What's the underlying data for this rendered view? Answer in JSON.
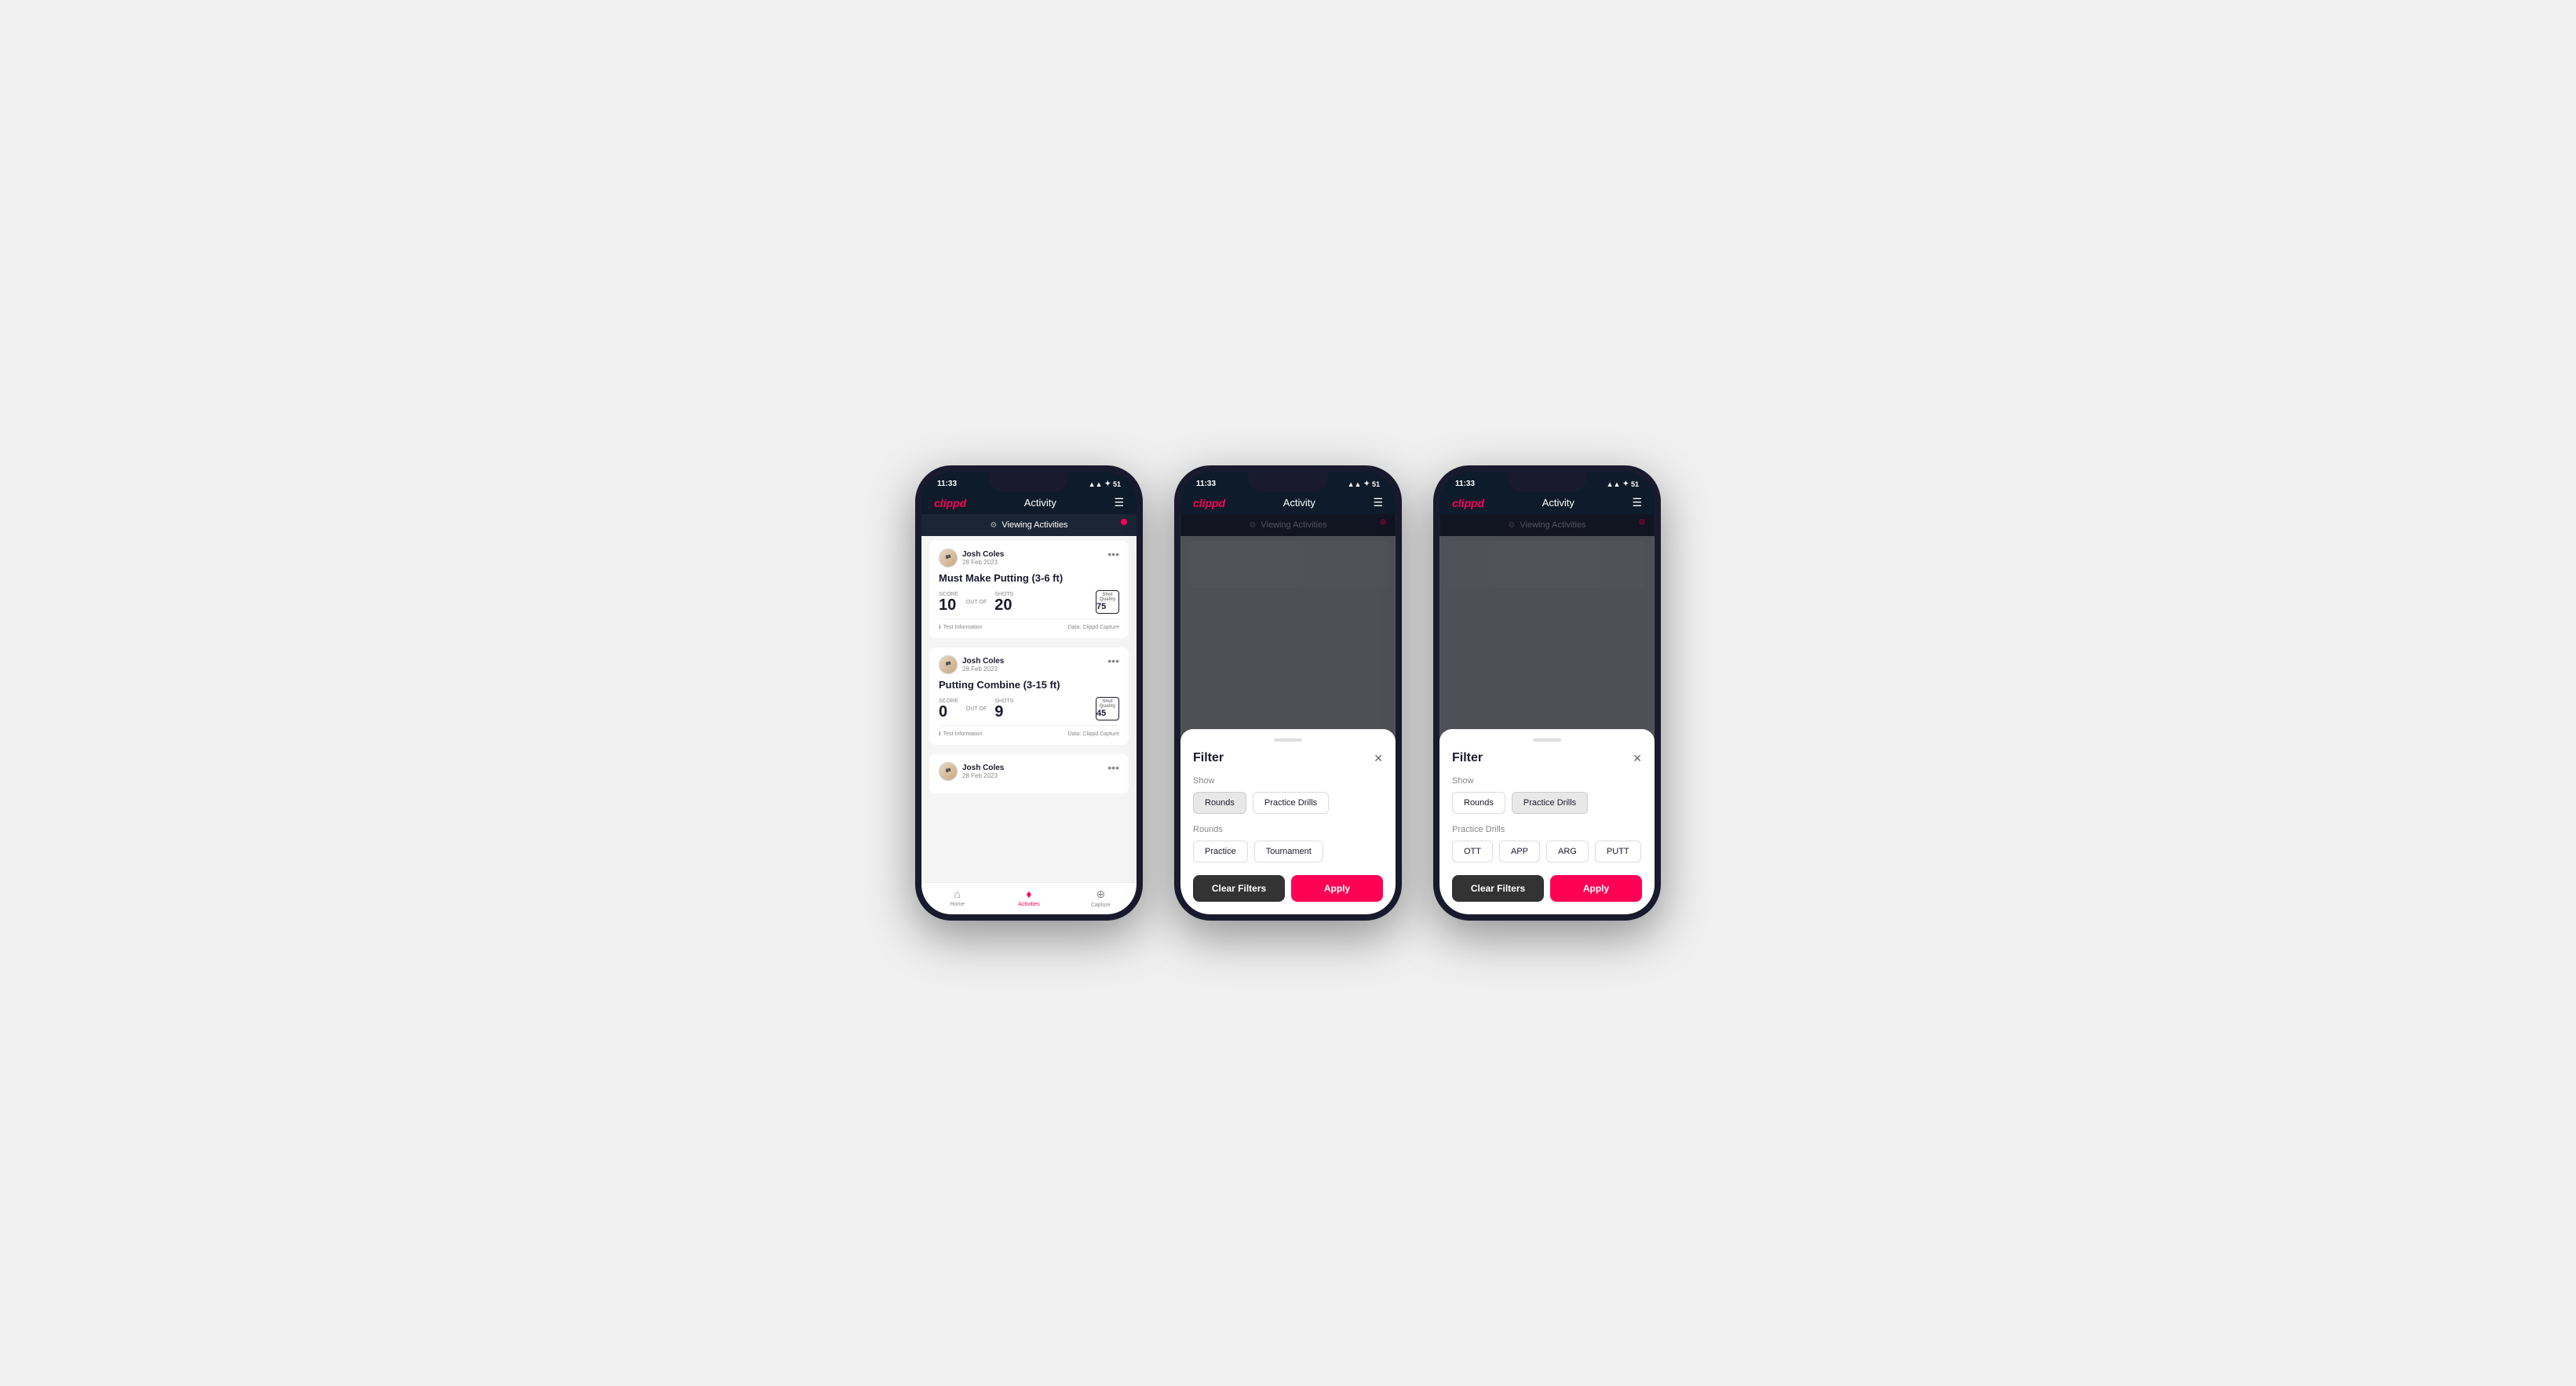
{
  "phones": [
    {
      "id": "phone-1",
      "status": {
        "time": "11:33",
        "icons": "▲▲ ✦ 51"
      },
      "header": {
        "logo": "clippd",
        "title": "Activity",
        "menu_icon": "☰"
      },
      "viewing_bar": {
        "text": "Viewing Activities",
        "has_dot": true
      },
      "cards": [
        {
          "user": "Josh Coles",
          "date": "28 Feb 2023",
          "title": "Must Make Putting (3-6 ft)",
          "score_label": "Score",
          "score": "10",
          "out_of_label": "OUT OF",
          "shots_label": "Shots",
          "shots": "20",
          "shot_quality_label": "Shot Quality",
          "shot_quality": "75",
          "info": "Test Information",
          "data_source": "Data: Clippd Capture"
        },
        {
          "user": "Josh Coles",
          "date": "28 Feb 2023",
          "title": "Putting Combine (3-15 ft)",
          "score_label": "Score",
          "score": "0",
          "out_of_label": "OUT OF",
          "shots_label": "Shots",
          "shots": "9",
          "shot_quality_label": "Shot Quality",
          "shot_quality": "45",
          "info": "Test Information",
          "data_source": "Data: Clippd Capture"
        },
        {
          "user": "Josh Coles",
          "date": "28 Feb 2023",
          "title": "",
          "score_label": "",
          "score": "",
          "out_of_label": "",
          "shots_label": "",
          "shots": "",
          "shot_quality_label": "",
          "shot_quality": "",
          "info": "",
          "data_source": ""
        }
      ],
      "bottom_nav": [
        {
          "icon": "⌂",
          "label": "Home",
          "active": false
        },
        {
          "icon": "♦",
          "label": "Activities",
          "active": true
        },
        {
          "icon": "⊕",
          "label": "Capture",
          "active": false
        }
      ],
      "show_modal": false
    },
    {
      "id": "phone-2",
      "status": {
        "time": "11:33",
        "icons": "▲▲ ✦ 51"
      },
      "header": {
        "logo": "clippd",
        "title": "Activity",
        "menu_icon": "☰"
      },
      "viewing_bar": {
        "text": "Viewing Activities",
        "has_dot": true
      },
      "show_modal": true,
      "modal": {
        "title": "Filter",
        "close_icon": "✕",
        "show_label": "Show",
        "show_options": [
          {
            "label": "Rounds",
            "active": true
          },
          {
            "label": "Practice Drills",
            "active": false
          }
        ],
        "rounds_label": "Rounds",
        "rounds_options": [
          {
            "label": "Practice",
            "active": false
          },
          {
            "label": "Tournament",
            "active": false
          }
        ],
        "practice_drills_label": "",
        "practice_drills_options": [],
        "clear_label": "Clear Filters",
        "apply_label": "Apply"
      }
    },
    {
      "id": "phone-3",
      "status": {
        "time": "11:33",
        "icons": "▲▲ ✦ 51"
      },
      "header": {
        "logo": "clippd",
        "title": "Activity",
        "menu_icon": "☰"
      },
      "viewing_bar": {
        "text": "Viewing Activities",
        "has_dot": true
      },
      "show_modal": true,
      "modal": {
        "title": "Filter",
        "close_icon": "✕",
        "show_label": "Show",
        "show_options": [
          {
            "label": "Rounds",
            "active": false
          },
          {
            "label": "Practice Drills",
            "active": true
          }
        ],
        "rounds_label": "",
        "rounds_options": [],
        "practice_drills_label": "Practice Drills",
        "practice_drills_options": [
          {
            "label": "OTT",
            "active": false
          },
          {
            "label": "APP",
            "active": false
          },
          {
            "label": "ARG",
            "active": false
          },
          {
            "label": "PUTT",
            "active": false
          }
        ],
        "clear_label": "Clear Filters",
        "apply_label": "Apply"
      }
    }
  ]
}
